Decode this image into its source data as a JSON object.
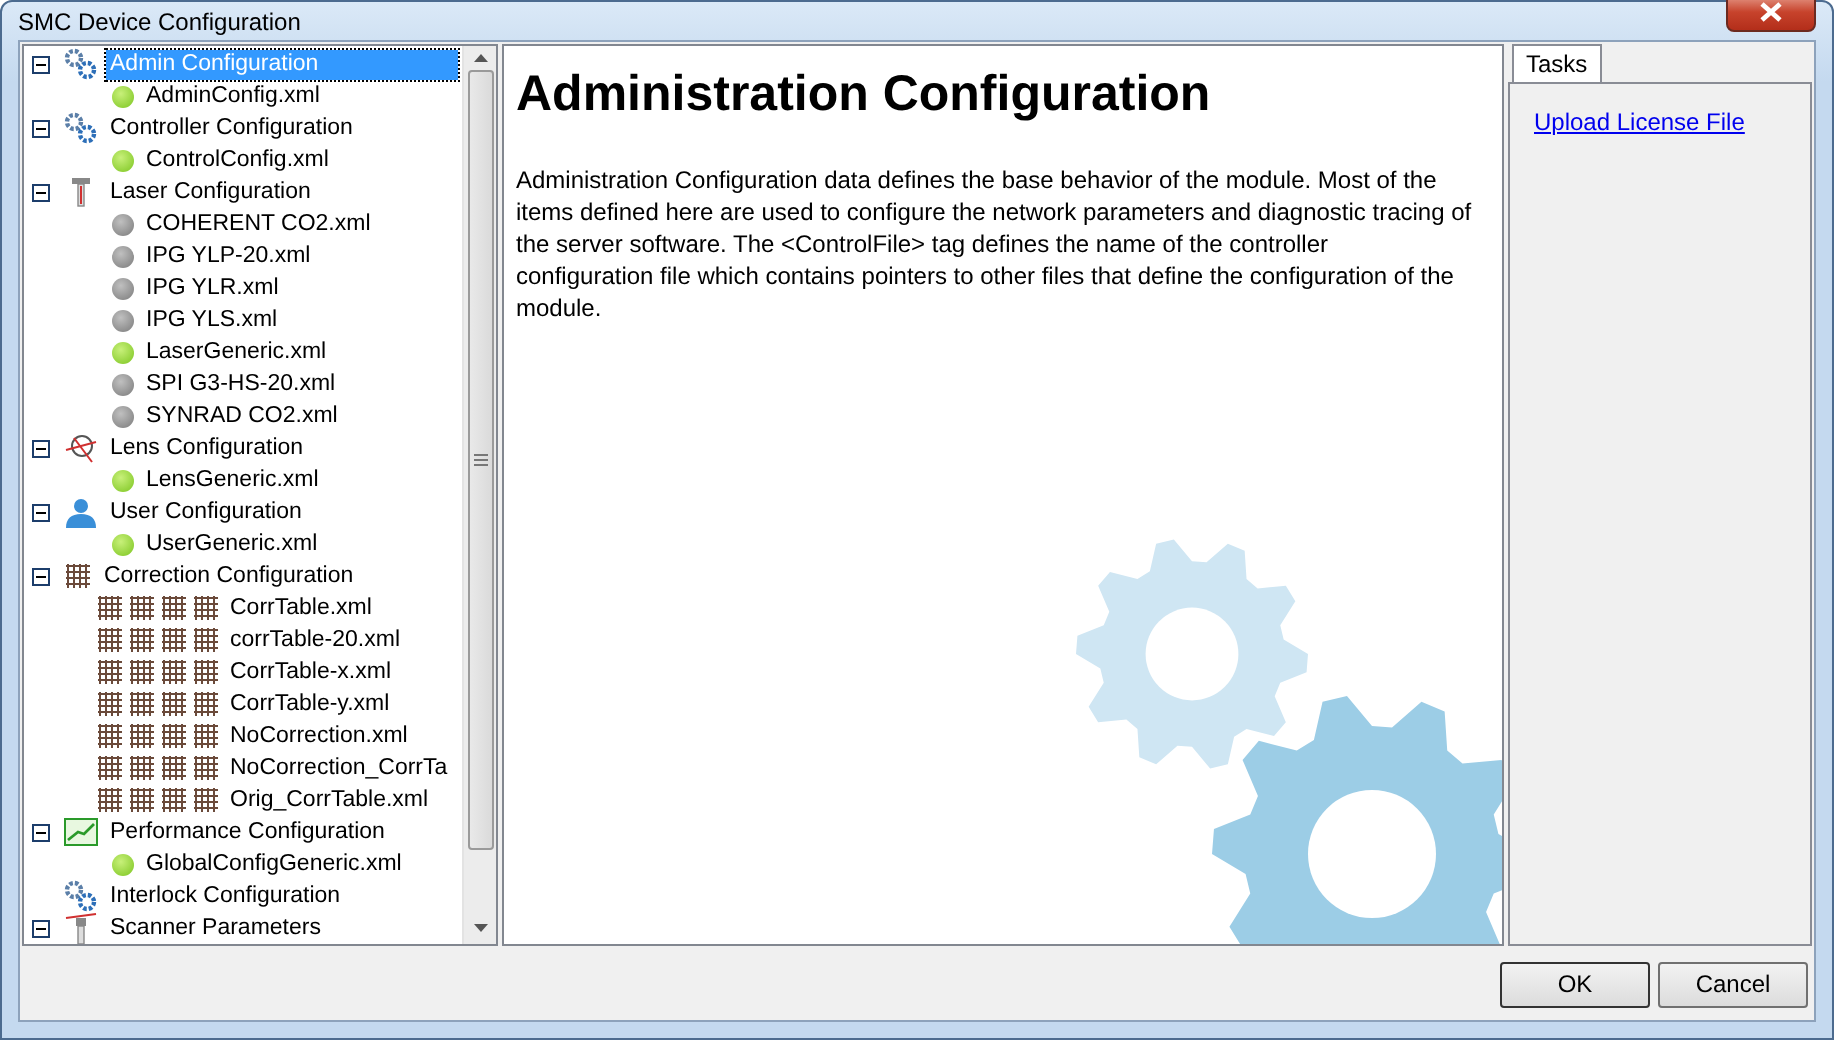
{
  "window": {
    "title": "SMC Device Configuration"
  },
  "tree": [
    {
      "label": "Admin Configuration",
      "kind": "gears",
      "expanded": true,
      "selected": true,
      "children": [
        {
          "label": "AdminConfig.xml",
          "kind": "file",
          "active": true
        }
      ]
    },
    {
      "label": "Controller Configuration",
      "kind": "gears",
      "expanded": true,
      "selected": false,
      "children": [
        {
          "label": "ControlConfig.xml",
          "kind": "file",
          "active": true
        }
      ]
    },
    {
      "label": "Laser Configuration",
      "kind": "laser",
      "expanded": true,
      "selected": false,
      "children": [
        {
          "label": "COHERENT CO2.xml",
          "kind": "file",
          "active": false
        },
        {
          "label": "IPG YLP-20.xml",
          "kind": "file",
          "active": false
        },
        {
          "label": "IPG YLR.xml",
          "kind": "file",
          "active": false
        },
        {
          "label": "IPG YLS.xml",
          "kind": "file",
          "active": false
        },
        {
          "label": "LaserGeneric.xml",
          "kind": "file",
          "active": true
        },
        {
          "label": "SPI G3-HS-20.xml",
          "kind": "file",
          "active": false
        },
        {
          "label": "SYNRAD CO2.xml",
          "kind": "file",
          "active": false
        }
      ]
    },
    {
      "label": "Lens Configuration",
      "kind": "lens",
      "expanded": true,
      "selected": false,
      "children": [
        {
          "label": "LensGeneric.xml",
          "kind": "file",
          "active": true
        }
      ]
    },
    {
      "label": "User Configuration",
      "kind": "user",
      "expanded": true,
      "selected": false,
      "children": [
        {
          "label": "UserGeneric.xml",
          "kind": "file",
          "active": true
        }
      ]
    },
    {
      "label": "Correction Configuration",
      "kind": "grid",
      "expanded": true,
      "selected": false,
      "children": [
        {
          "label": "CorrTable.xml",
          "kind": "table"
        },
        {
          "label": "corrTable-20.xml",
          "kind": "table"
        },
        {
          "label": "CorrTable-x.xml",
          "kind": "table"
        },
        {
          "label": "CorrTable-y.xml",
          "kind": "table"
        },
        {
          "label": "NoCorrection.xml",
          "kind": "table"
        },
        {
          "label": "NoCorrection_CorrTa",
          "kind": "table"
        },
        {
          "label": "Orig_CorrTable.xml",
          "kind": "table"
        }
      ]
    },
    {
      "label": "Performance Configuration",
      "kind": "chart",
      "expanded": true,
      "selected": false,
      "children": [
        {
          "label": "GlobalConfigGeneric.xml",
          "kind": "file",
          "active": true
        }
      ]
    },
    {
      "label": "Interlock Configuration",
      "kind": "gears",
      "selected": false
    },
    {
      "label": "Scanner Parameters",
      "kind": "scanner",
      "expanded": true,
      "selected": false
    }
  ],
  "content": {
    "heading": "Administration Configuration",
    "body": "Administration Configuration data defines the base behavior of the module.  Most of the items defined here are used to configure the network parameters and diagnostic tracing of the server software.  The <ControlFile> tag defines the name of the controller configuration file which contains pointers to other files that define the configuration of the module."
  },
  "tasks": {
    "tab": "Tasks",
    "links": [
      "Upload License File"
    ]
  },
  "buttons": [
    "OK",
    "Cancel"
  ]
}
